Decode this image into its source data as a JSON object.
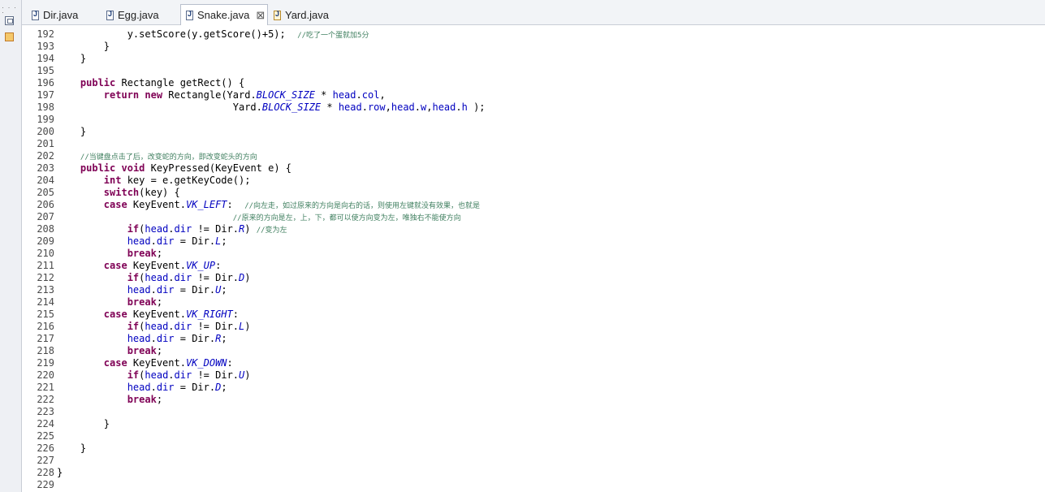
{
  "tabs": [
    {
      "label": "Dir.java",
      "active": false,
      "modified": false,
      "icon": "java-file-icon"
    },
    {
      "label": "Egg.java",
      "active": false,
      "modified": false,
      "icon": "java-file-icon"
    },
    {
      "label": "Snake.java",
      "active": true,
      "modified": false,
      "icon": "java-file-icon",
      "close": "⊠"
    },
    {
      "label": "Yard.java",
      "active": false,
      "modified": true,
      "icon": "java-file-icon"
    }
  ],
  "colors": {
    "keyword": "#7f0055",
    "field": "#0000c0",
    "comment": "#3f7f5f",
    "line_number": "#4a4a4a"
  },
  "code": {
    "lines": [
      {
        "n": "192",
        "tokens": [
          [
            "p",
            "            y.setScore(y.getScore()+5);  "
          ],
          [
            "c",
            "//吃了一个蛋就加5分"
          ]
        ]
      },
      {
        "n": "193",
        "tokens": [
          [
            "p",
            "        }"
          ]
        ]
      },
      {
        "n": "194",
        "tokens": [
          [
            "p",
            "    }"
          ]
        ]
      },
      {
        "n": "195",
        "tokens": []
      },
      {
        "n": "196",
        "tokens": [
          [
            "p",
            "    "
          ],
          [
            "k",
            "public"
          ],
          [
            "p",
            " Rectangle getRect() {"
          ]
        ]
      },
      {
        "n": "197",
        "tokens": [
          [
            "p",
            "        "
          ],
          [
            "k",
            "return"
          ],
          [
            "p",
            " "
          ],
          [
            "k",
            "new"
          ],
          [
            "p",
            " Rectangle(Yard."
          ],
          [
            "s",
            "BLOCK_SIZE"
          ],
          [
            "p",
            " * "
          ],
          [
            "f",
            "head"
          ],
          [
            "p",
            "."
          ],
          [
            "f",
            "col"
          ],
          [
            "p",
            ","
          ]
        ]
      },
      {
        "n": "198",
        "tokens": [
          [
            "p",
            "                              Yard."
          ],
          [
            "s",
            "BLOCK_SIZE"
          ],
          [
            "p",
            " * "
          ],
          [
            "f",
            "head"
          ],
          [
            "p",
            "."
          ],
          [
            "f",
            "row"
          ],
          [
            "p",
            ","
          ],
          [
            "f",
            "head"
          ],
          [
            "p",
            "."
          ],
          [
            "f",
            "w"
          ],
          [
            "p",
            ","
          ],
          [
            "f",
            "head"
          ],
          [
            "p",
            "."
          ],
          [
            "f",
            "h"
          ],
          [
            "p",
            " );"
          ]
        ]
      },
      {
        "n": "199",
        "tokens": []
      },
      {
        "n": "200",
        "tokens": [
          [
            "p",
            "    }"
          ]
        ]
      },
      {
        "n": "201",
        "tokens": []
      },
      {
        "n": "202",
        "tokens": [
          [
            "p",
            "    "
          ],
          [
            "c",
            "//当键盘点击了后，改变蛇的方向，即改变蛇头的方向"
          ]
        ]
      },
      {
        "n": "203",
        "tokens": [
          [
            "p",
            "    "
          ],
          [
            "k",
            "public"
          ],
          [
            "p",
            " "
          ],
          [
            "k",
            "void"
          ],
          [
            "p",
            " KeyPressed(KeyEvent e) {"
          ]
        ]
      },
      {
        "n": "204",
        "tokens": [
          [
            "p",
            "        "
          ],
          [
            "k",
            "int"
          ],
          [
            "p",
            " key = e.getKeyCode();"
          ]
        ]
      },
      {
        "n": "205",
        "tokens": [
          [
            "p",
            "        "
          ],
          [
            "k",
            "switch"
          ],
          [
            "p",
            "(key) {"
          ]
        ]
      },
      {
        "n": "206",
        "tokens": [
          [
            "p",
            "        "
          ],
          [
            "k",
            "case"
          ],
          [
            "p",
            " KeyEvent."
          ],
          [
            "s",
            "VK_LEFT"
          ],
          [
            "p",
            ":  "
          ],
          [
            "c",
            "//向左走，如过原来的方向是向右的话，则使用左键就没有效果，也就是"
          ]
        ]
      },
      {
        "n": "207",
        "tokens": [
          [
            "p",
            "                              "
          ],
          [
            "c",
            "//原来的方向是左，上，下，都可以使方向变为左，唯独右不能使方向"
          ]
        ]
      },
      {
        "n": "208",
        "tokens": [
          [
            "p",
            "            "
          ],
          [
            "k",
            "if"
          ],
          [
            "p",
            "("
          ],
          [
            "f",
            "head"
          ],
          [
            "p",
            "."
          ],
          [
            "f",
            "dir"
          ],
          [
            "p",
            " != Dir."
          ],
          [
            "s",
            "R"
          ],
          [
            "p",
            ") "
          ],
          [
            "c",
            "//变为左"
          ]
        ]
      },
      {
        "n": "209",
        "tokens": [
          [
            "p",
            "            "
          ],
          [
            "f",
            "head"
          ],
          [
            "p",
            "."
          ],
          [
            "f",
            "dir"
          ],
          [
            "p",
            " = Dir."
          ],
          [
            "s",
            "L"
          ],
          [
            "p",
            ";"
          ]
        ]
      },
      {
        "n": "210",
        "tokens": [
          [
            "p",
            "            "
          ],
          [
            "k",
            "break"
          ],
          [
            "p",
            ";"
          ]
        ]
      },
      {
        "n": "211",
        "tokens": [
          [
            "p",
            "        "
          ],
          [
            "k",
            "case"
          ],
          [
            "p",
            " KeyEvent."
          ],
          [
            "s",
            "VK_UP"
          ],
          [
            "p",
            ":"
          ]
        ]
      },
      {
        "n": "212",
        "tokens": [
          [
            "p",
            "            "
          ],
          [
            "k",
            "if"
          ],
          [
            "p",
            "("
          ],
          [
            "f",
            "head"
          ],
          [
            "p",
            "."
          ],
          [
            "f",
            "dir"
          ],
          [
            "p",
            " != Dir."
          ],
          [
            "s",
            "D"
          ],
          [
            "p",
            ")"
          ]
        ]
      },
      {
        "n": "213",
        "tokens": [
          [
            "p",
            "            "
          ],
          [
            "f",
            "head"
          ],
          [
            "p",
            "."
          ],
          [
            "f",
            "dir"
          ],
          [
            "p",
            " = Dir."
          ],
          [
            "s",
            "U"
          ],
          [
            "p",
            ";"
          ]
        ]
      },
      {
        "n": "214",
        "tokens": [
          [
            "p",
            "            "
          ],
          [
            "k",
            "break"
          ],
          [
            "p",
            ";"
          ]
        ]
      },
      {
        "n": "215",
        "tokens": [
          [
            "p",
            "        "
          ],
          [
            "k",
            "case"
          ],
          [
            "p",
            " KeyEvent."
          ],
          [
            "s",
            "VK_RIGHT"
          ],
          [
            "p",
            ":"
          ]
        ]
      },
      {
        "n": "216",
        "tokens": [
          [
            "p",
            "            "
          ],
          [
            "k",
            "if"
          ],
          [
            "p",
            "("
          ],
          [
            "f",
            "head"
          ],
          [
            "p",
            "."
          ],
          [
            "f",
            "dir"
          ],
          [
            "p",
            " != Dir."
          ],
          [
            "s",
            "L"
          ],
          [
            "p",
            ")"
          ]
        ]
      },
      {
        "n": "217",
        "tokens": [
          [
            "p",
            "            "
          ],
          [
            "f",
            "head"
          ],
          [
            "p",
            "."
          ],
          [
            "f",
            "dir"
          ],
          [
            "p",
            " = Dir."
          ],
          [
            "s",
            "R"
          ],
          [
            "p",
            ";"
          ]
        ]
      },
      {
        "n": "218",
        "tokens": [
          [
            "p",
            "            "
          ],
          [
            "k",
            "break"
          ],
          [
            "p",
            ";"
          ]
        ]
      },
      {
        "n": "219",
        "tokens": [
          [
            "p",
            "        "
          ],
          [
            "k",
            "case"
          ],
          [
            "p",
            " KeyEvent."
          ],
          [
            "s",
            "VK_DOWN"
          ],
          [
            "p",
            ":"
          ]
        ]
      },
      {
        "n": "220",
        "tokens": [
          [
            "p",
            "            "
          ],
          [
            "k",
            "if"
          ],
          [
            "p",
            "("
          ],
          [
            "f",
            "head"
          ],
          [
            "p",
            "."
          ],
          [
            "f",
            "dir"
          ],
          [
            "p",
            " != Dir."
          ],
          [
            "s",
            "U"
          ],
          [
            "p",
            ")"
          ]
        ]
      },
      {
        "n": "221",
        "tokens": [
          [
            "p",
            "            "
          ],
          [
            "f",
            "head"
          ],
          [
            "p",
            "."
          ],
          [
            "f",
            "dir"
          ],
          [
            "p",
            " = Dir."
          ],
          [
            "s",
            "D"
          ],
          [
            "p",
            ";"
          ]
        ]
      },
      {
        "n": "222",
        "tokens": [
          [
            "p",
            "            "
          ],
          [
            "k",
            "break"
          ],
          [
            "p",
            ";"
          ]
        ]
      },
      {
        "n": "223",
        "tokens": []
      },
      {
        "n": "224",
        "tokens": [
          [
            "p",
            "        }"
          ]
        ]
      },
      {
        "n": "225",
        "tokens": []
      },
      {
        "n": "226",
        "tokens": [
          [
            "p",
            "    }"
          ]
        ]
      },
      {
        "n": "227",
        "tokens": []
      },
      {
        "n": "228",
        "tokens": [
          [
            "p",
            "}"
          ]
        ]
      },
      {
        "n": "229",
        "tokens": []
      }
    ]
  }
}
